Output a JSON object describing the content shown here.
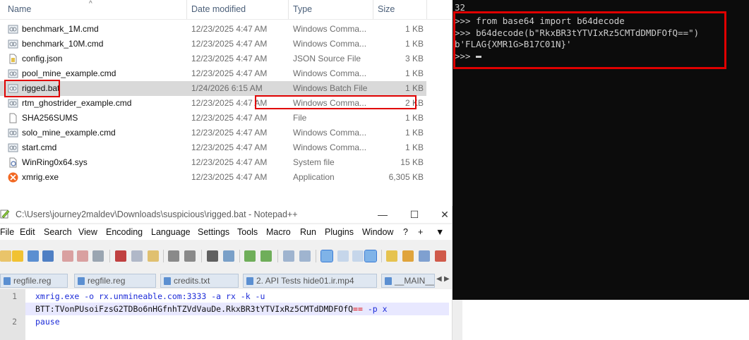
{
  "explorer": {
    "columns": {
      "name": "Name",
      "date": "Date modified",
      "type": "Type",
      "size": "Size"
    },
    "files": [
      {
        "name": "benchmark_1M.cmd",
        "date": "12/23/2025 4:47 AM",
        "type": "Windows Comma...",
        "size": "1 KB",
        "icon": "cmd-file-icon"
      },
      {
        "name": "benchmark_10M.cmd",
        "date": "12/23/2025 4:47 AM",
        "type": "Windows Comma...",
        "size": "1 KB",
        "icon": "cmd-file-icon"
      },
      {
        "name": "config.json",
        "date": "12/23/2025 4:47 AM",
        "type": "JSON Source File",
        "size": "3 KB",
        "icon": "json-file-icon"
      },
      {
        "name": "pool_mine_example.cmd",
        "date": "12/23/2025 4:47 AM",
        "type": "Windows Comma...",
        "size": "1 KB",
        "icon": "cmd-file-icon"
      },
      {
        "name": "rigged.bat",
        "date": "1/24/2026 6:15 AM",
        "type": "Windows Batch File",
        "size": "1 KB",
        "icon": "bat-file-icon"
      },
      {
        "name": "rtm_ghostrider_example.cmd",
        "date": "12/23/2025 4:47 AM",
        "type": "Windows Comma...",
        "size": "2 KB",
        "icon": "cmd-file-icon"
      },
      {
        "name": "SHA256SUMS",
        "date": "12/23/2025 4:47 AM",
        "type": "File",
        "size": "1 KB",
        "icon": "blank-file-icon"
      },
      {
        "name": "solo_mine_example.cmd",
        "date": "12/23/2025 4:47 AM",
        "type": "Windows Comma...",
        "size": "1 KB",
        "icon": "cmd-file-icon"
      },
      {
        "name": "start.cmd",
        "date": "12/23/2025 4:47 AM",
        "type": "Windows Comma...",
        "size": "1 KB",
        "icon": "cmd-file-icon"
      },
      {
        "name": "WinRing0x64.sys",
        "date": "12/23/2025 4:47 AM",
        "type": "System file",
        "size": "15 KB",
        "icon": "sys-file-icon"
      },
      {
        "name": "xmrig.exe",
        "date": "12/23/2025 4:47 AM",
        "type": "Application",
        "size": "6,305 KB",
        "icon": "xmrig-app-icon"
      }
    ]
  },
  "notepad": {
    "title": "C:\\Users\\journey2maldev\\Downloads\\suspicious\\rigged.bat - Notepad++",
    "menu": [
      "File",
      "Edit",
      "Search",
      "View",
      "Encoding",
      "Language",
      "Settings",
      "Tools",
      "Macro",
      "Run",
      "Plugins",
      "Window",
      "?",
      "+",
      "▼"
    ],
    "tabs": [
      "regfile.reg",
      "regfile.reg",
      "credits.txt",
      "2. API Tests hide01.ir.mp4",
      "__MAIN__.c"
    ],
    "lines": {
      "l1_num": "1",
      "l1_a": "xmrig.exe -o rx.unmineable.com:3333 -a rx -k -u",
      "l1_b_prefix": "BTT:TVonPUsoiFzsG2TDBo6nHGfnhTZVdVauDe.",
      "l1_b_payload": "RkxBR3tYTVIxRz5CMTdDMDFOfQ",
      "l1_b_pad": "==",
      "l1_b_suffix": " -p x",
      "l2_num": "2",
      "l2": "pause"
    }
  },
  "terminal": {
    "line0": "32",
    "line1": ">>> from base64 import b64decode",
    "line2": ">>> b64decode(b\"RkxBR3tYTVIxRz5CMTdDMDFOfQ==\")",
    "line3": "b'FLAG{XMR1G>B17C01N}'",
    "prompt": ">>> "
  },
  "colors": {
    "highlight_red": "#e00000",
    "terminal_bg": "#0c0c0c",
    "code_blue": "#1c2bd8"
  }
}
